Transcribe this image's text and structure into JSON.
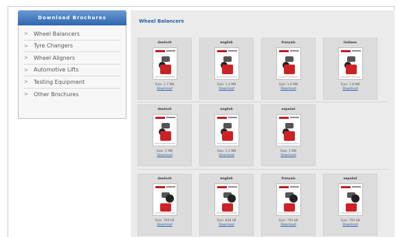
{
  "sidebar": {
    "header": "Download Brochures",
    "items": [
      {
        "label": "Wheel Balancers"
      },
      {
        "label": "Tyre Changers"
      },
      {
        "label": "Wheel Aligners"
      },
      {
        "label": "Automotive Lifts"
      },
      {
        "label": "Testing Equipment"
      },
      {
        "label": "Other Brochures"
      }
    ]
  },
  "main": {
    "title": "Wheel Balancers",
    "rows": [
      [
        {
          "lang": "deutsch",
          "size": "Size: 1.7 MB",
          "download": "Download"
        },
        {
          "lang": "english",
          "size": "Size: 1.4 MB",
          "download": "Download"
        },
        {
          "lang": "français",
          "size": "Size: 1.6 MB",
          "download": "Download"
        },
        {
          "lang": "italiano",
          "size": "Size: 1.8 MB",
          "download": "Download"
        }
      ],
      [
        {
          "lang": "deutsch",
          "size": "Size: 1 MB",
          "download": "Download"
        },
        {
          "lang": "english",
          "size": "Size: 1.2 MB",
          "download": "Download"
        },
        {
          "lang": "español",
          "size": "Size: 1 MB",
          "download": "Download"
        }
      ],
      [
        {
          "lang": "deutsch",
          "size": "Size: 769 kB",
          "download": "Download"
        },
        {
          "lang": "english",
          "size": "Size: 828 kB",
          "download": "Download"
        },
        {
          "lang": "français",
          "size": "Size: 793 kB",
          "download": "Download"
        },
        {
          "lang": "español",
          "size": "Size: 750 kB",
          "download": "Download"
        }
      ]
    ]
  },
  "colors": {
    "accent": "#2f66ad",
    "brand_red": "#cc2225"
  }
}
